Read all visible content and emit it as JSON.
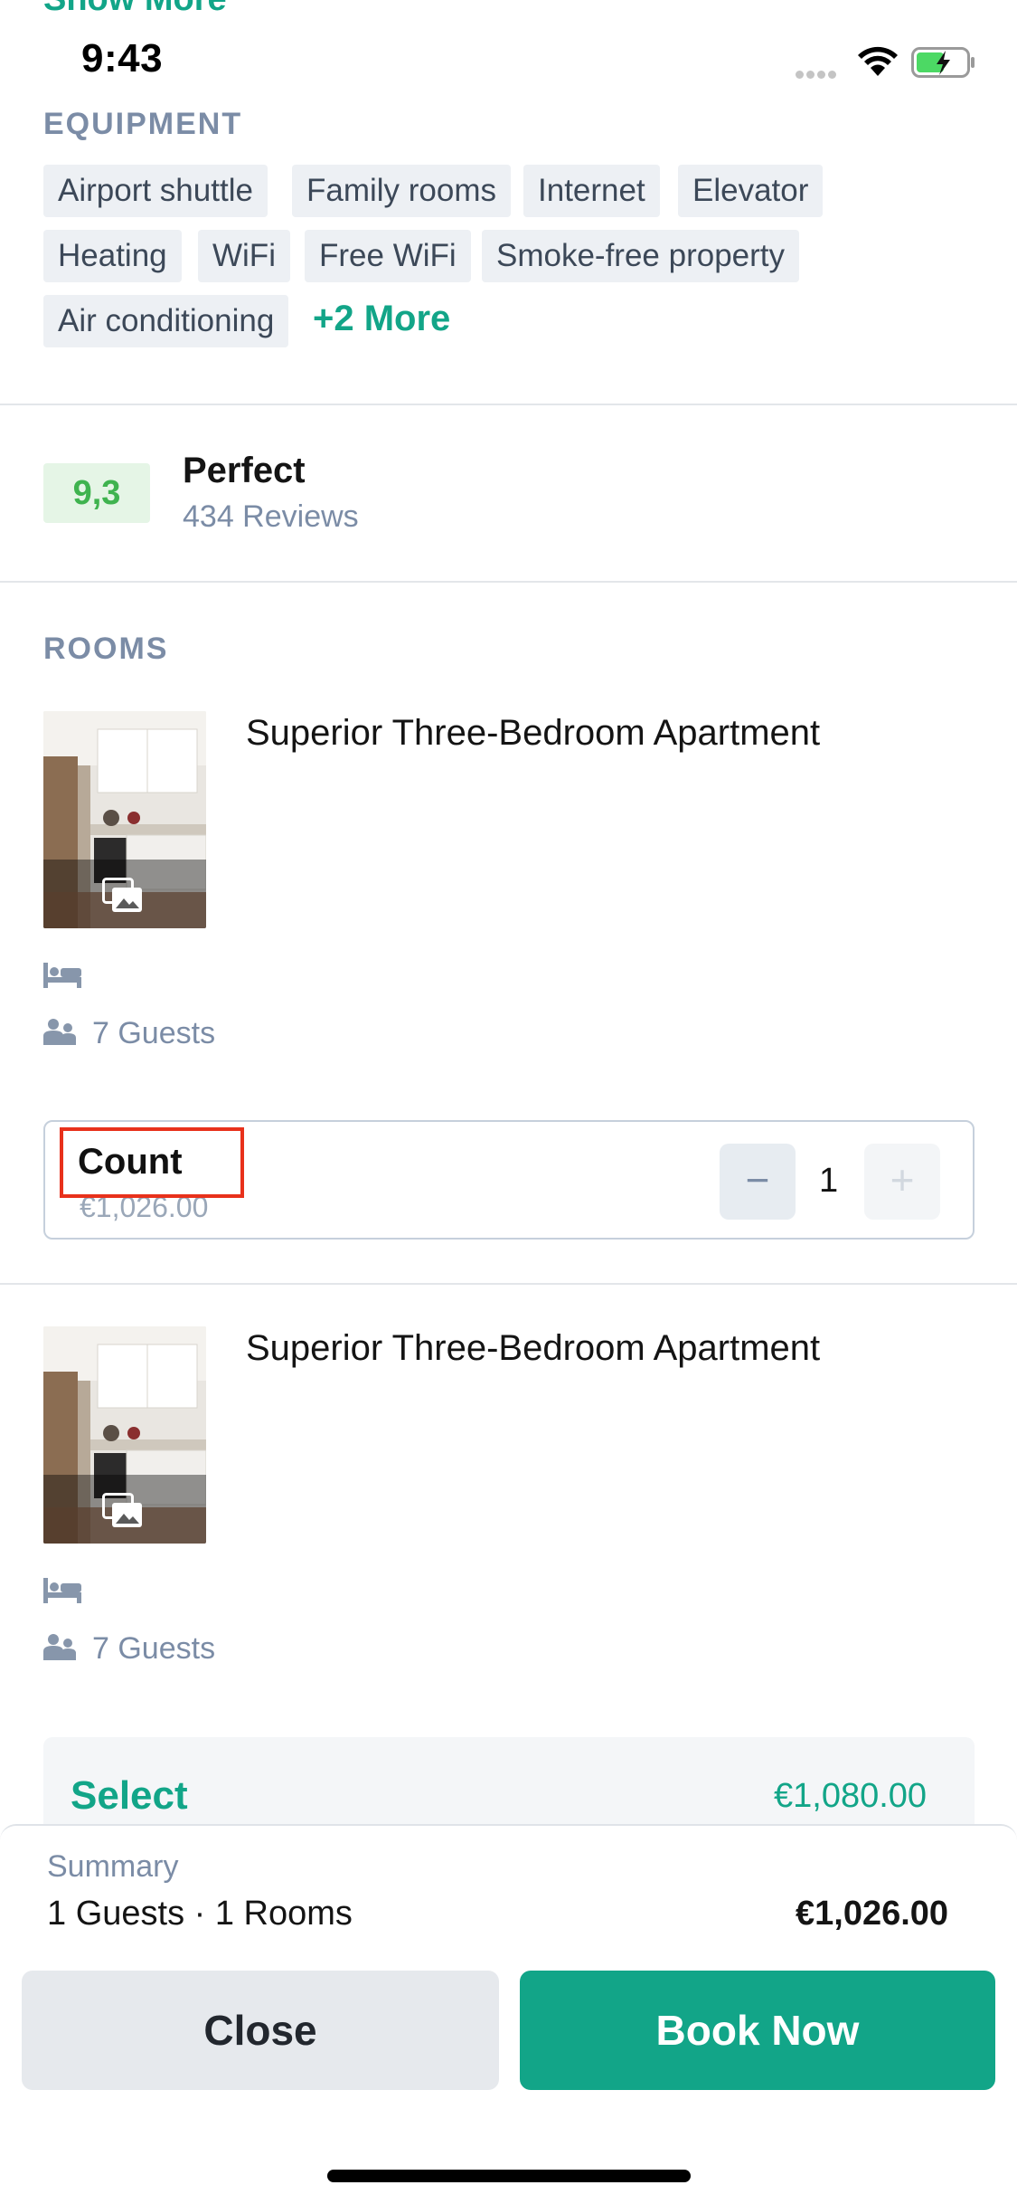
{
  "top_link": "Show More",
  "status_bar": {
    "time": "9:43"
  },
  "equipment": {
    "title": "EQUIPMENT",
    "chips": [
      "Airport shuttle",
      "Family rooms",
      "Internet",
      "Elevator",
      "Heating",
      "WiFi",
      "Free WiFi",
      "Smoke-free property",
      "Air conditioning"
    ],
    "more_label": "+2 More"
  },
  "rating": {
    "score": "9,3",
    "label": "Perfect",
    "reviews": "434 Reviews"
  },
  "rooms": {
    "title": "ROOMS",
    "items": [
      {
        "name": "Superior Three-Bedroom Apartment",
        "guests": "7 Guests"
      },
      {
        "name": "Superior Three-Bedroom Apartment",
        "guests": "7 Guests"
      }
    ],
    "count": {
      "label": "Count",
      "price": "€1,026.00",
      "minus": "−",
      "value": "1",
      "plus": "+"
    },
    "select": {
      "label": "Select",
      "price": "€1,080.00"
    }
  },
  "summary": {
    "label": "Summary",
    "detail": "1 Guests · 1 Rooms",
    "total": "€1,026.00"
  },
  "actions": {
    "close": "Close",
    "book": "Book Now"
  },
  "colors": {
    "accent": "#12a588",
    "muted": "#7b8ca6",
    "score_bg": "#e5f5e6",
    "score_text": "#3fb34f",
    "highlight": "#e8311b"
  }
}
